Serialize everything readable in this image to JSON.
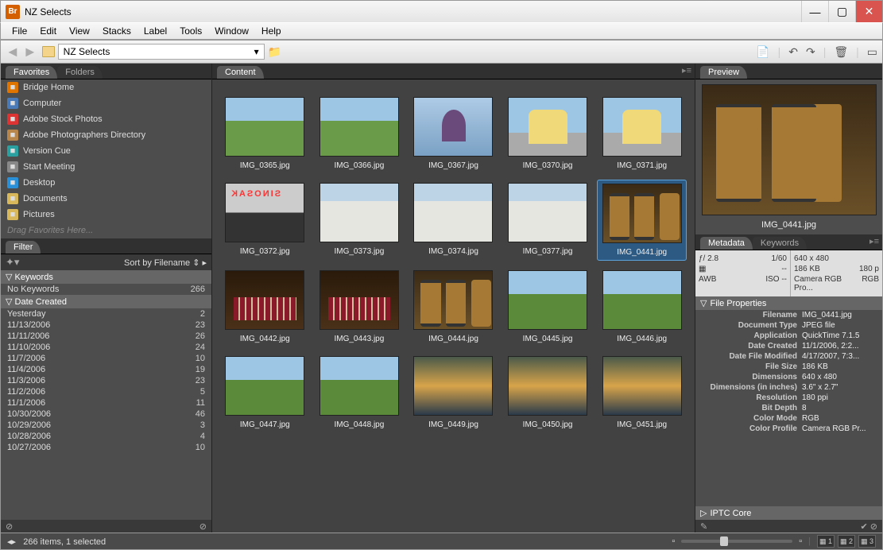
{
  "window": {
    "title": "NZ Selects",
    "app_badge": "Br"
  },
  "menus": [
    "File",
    "Edit",
    "View",
    "Stacks",
    "Label",
    "Tools",
    "Window",
    "Help"
  ],
  "location": {
    "folder": "NZ Selects"
  },
  "panels": {
    "favorites_tabs": [
      "Favorites",
      "Folders"
    ],
    "favorites": {
      "items": [
        {
          "label": "Bridge Home",
          "color": "#e07400"
        },
        {
          "label": "Computer",
          "color": "#4a7ab8"
        },
        {
          "label": "Adobe Stock Photos",
          "color": "#d33"
        },
        {
          "label": "Adobe Photographers Directory",
          "color": "#b8864a"
        },
        {
          "label": "Version Cue",
          "color": "#2aa0a0"
        },
        {
          "label": "Start Meeting",
          "color": "#888"
        },
        {
          "label": "Desktop",
          "color": "#2a90d8"
        },
        {
          "label": "Documents",
          "color": "#d8b85a"
        },
        {
          "label": "Pictures",
          "color": "#d8b85a"
        }
      ],
      "hint": "Drag Favorites Here..."
    },
    "filter": {
      "tab": "Filter",
      "sort": "Sort by Filename",
      "sections": [
        {
          "name": "Keywords",
          "rows": [
            {
              "label": "No Keywords",
              "count": 266
            }
          ]
        },
        {
          "name": "Date Created",
          "rows": [
            {
              "label": "Yesterday",
              "count": 2
            },
            {
              "label": "11/13/2006",
              "count": 23
            },
            {
              "label": "11/11/2006",
              "count": 26
            },
            {
              "label": "11/10/2006",
              "count": 24
            },
            {
              "label": "11/7/2006",
              "count": 10
            },
            {
              "label": "11/4/2006",
              "count": 19
            },
            {
              "label": "11/3/2006",
              "count": 23
            },
            {
              "label": "11/2/2006",
              "count": 5
            },
            {
              "label": "11/1/2006",
              "count": 11
            },
            {
              "label": "10/30/2006",
              "count": 46
            },
            {
              "label": "10/29/2006",
              "count": 3
            },
            {
              "label": "10/28/2006",
              "count": 4
            },
            {
              "label": "10/27/2006",
              "count": 10
            }
          ]
        }
      ]
    },
    "content_tab": "Content",
    "preview_tab": "Preview",
    "metadata_tabs": [
      "Metadata",
      "Keywords"
    ]
  },
  "thumbnails": [
    {
      "name": "IMG_0365.jpg",
      "cls": "t-hills"
    },
    {
      "name": "IMG_0366.jpg",
      "cls": "t-hills"
    },
    {
      "name": "IMG_0367.jpg",
      "cls": "t-person"
    },
    {
      "name": "IMG_0370.jpg",
      "cls": "t-arch"
    },
    {
      "name": "IMG_0371.jpg",
      "cls": "t-arch"
    },
    {
      "name": "IMG_0372.jpg",
      "cls": "t-sign"
    },
    {
      "name": "IMG_0373.jpg",
      "cls": "t-bldg"
    },
    {
      "name": "IMG_0374.jpg",
      "cls": "t-bldg"
    },
    {
      "name": "IMG_0377.jpg",
      "cls": "t-bldg"
    },
    {
      "name": "IMG_0441.jpg",
      "cls": "t-barrels",
      "selected": true
    },
    {
      "name": "IMG_0442.jpg",
      "cls": "t-wine"
    },
    {
      "name": "IMG_0443.jpg",
      "cls": "t-wine"
    },
    {
      "name": "IMG_0444.jpg",
      "cls": "t-barrels"
    },
    {
      "name": "IMG_0445.jpg",
      "cls": "t-vine"
    },
    {
      "name": "IMG_0446.jpg",
      "cls": "t-vine"
    },
    {
      "name": "IMG_0447.jpg",
      "cls": "t-vine"
    },
    {
      "name": "IMG_0448.jpg",
      "cls": "t-vine"
    },
    {
      "name": "IMG_0449.jpg",
      "cls": "t-sunset"
    },
    {
      "name": "IMG_0450.jpg",
      "cls": "t-sunset"
    },
    {
      "name": "IMG_0451.jpg",
      "cls": "t-sunset"
    }
  ],
  "preview": {
    "name": "IMG_0441.jpg",
    "cls": "t-barrels"
  },
  "metadata": {
    "summary": {
      "aperture": "ƒ/ 2.8",
      "shutter": "1/60",
      "awb": "AWB",
      "ev": "--",
      "iso_label": "ISO",
      "iso": "--",
      "dim": "640 x 480",
      "size": "186 KB",
      "res": "180 p",
      "profile": "Camera RGB Pro...",
      "mode": "RGB"
    },
    "file_props_head": "File Properties",
    "file_props": [
      {
        "label": "Filename",
        "val": "IMG_0441.jpg"
      },
      {
        "label": "Document Type",
        "val": "JPEG file"
      },
      {
        "label": "Application",
        "val": "QuickTime 7.1.5"
      },
      {
        "label": "Date Created",
        "val": "11/1/2006, 2:2..."
      },
      {
        "label": "Date File Modified",
        "val": "4/17/2007, 7:3..."
      },
      {
        "label": "File Size",
        "val": "186 KB"
      },
      {
        "label": "Dimensions",
        "val": "640 x 480"
      },
      {
        "label": "Dimensions (in inches)",
        "val": "3.6\" x 2.7\""
      },
      {
        "label": "Resolution",
        "val": "180 ppi"
      },
      {
        "label": "Bit Depth",
        "val": "8"
      },
      {
        "label": "Color Mode",
        "val": "RGB"
      },
      {
        "label": "Color Profile",
        "val": "Camera RGB Pr..."
      }
    ],
    "iptc_head": "IPTC Core"
  },
  "status": {
    "text": "266 items, 1 selected",
    "views": [
      "1",
      "2",
      "3"
    ]
  }
}
